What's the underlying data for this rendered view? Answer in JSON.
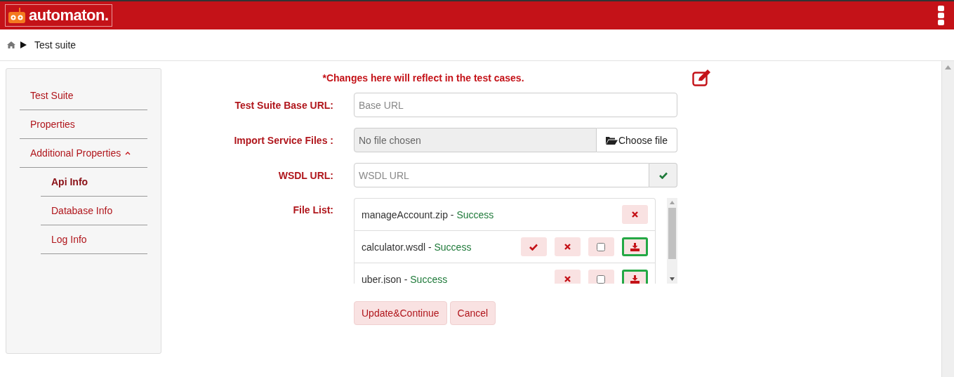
{
  "header": {
    "logo": "automaton."
  },
  "breadcrumb": {
    "current": "Test suite"
  },
  "sidebar": {
    "items": [
      {
        "label": "Test Suite",
        "selected": false
      },
      {
        "label": "Properties",
        "selected": false
      },
      {
        "label": "Additional Properties",
        "selected": false,
        "expanded": true,
        "children": [
          {
            "label": "Api Info",
            "selected": true
          },
          {
            "label": "Database Info",
            "selected": false
          },
          {
            "label": "Log Info",
            "selected": false
          }
        ]
      }
    ]
  },
  "form": {
    "notice": "*Changes here will reflect in the test cases.",
    "fields": [
      {
        "kind": "text",
        "label": "Test Suite Base URL:",
        "placeholder": "Base URL"
      },
      {
        "kind": "file",
        "label": "Import Service Files :",
        "value": "No file chosen",
        "button": "Choose file"
      },
      {
        "kind": "confirm",
        "label": "WSDL URL:",
        "placeholder": "WSDL URL"
      }
    ],
    "file_list": {
      "label": "File List:",
      "separator": "-",
      "files": [
        {
          "name": "manageAccount.zip",
          "status": "Success",
          "actions": [
            {
              "kind": "delete"
            }
          ]
        },
        {
          "name": "calculator.wsdl",
          "status": "Success",
          "actions": [
            {
              "kind": "approve"
            },
            {
              "kind": "delete"
            },
            {
              "kind": "checkbox",
              "checked": false
            },
            {
              "kind": "download",
              "highlighted": true
            }
          ]
        },
        {
          "name": "uber.json",
          "status": "Success",
          "actions": [
            {
              "kind": "delete"
            },
            {
              "kind": "checkbox",
              "checked": false
            },
            {
              "kind": "download",
              "highlighted": true
            }
          ]
        }
      ]
    },
    "buttons": [
      "Update&Continue",
      "Cancel"
    ]
  }
}
